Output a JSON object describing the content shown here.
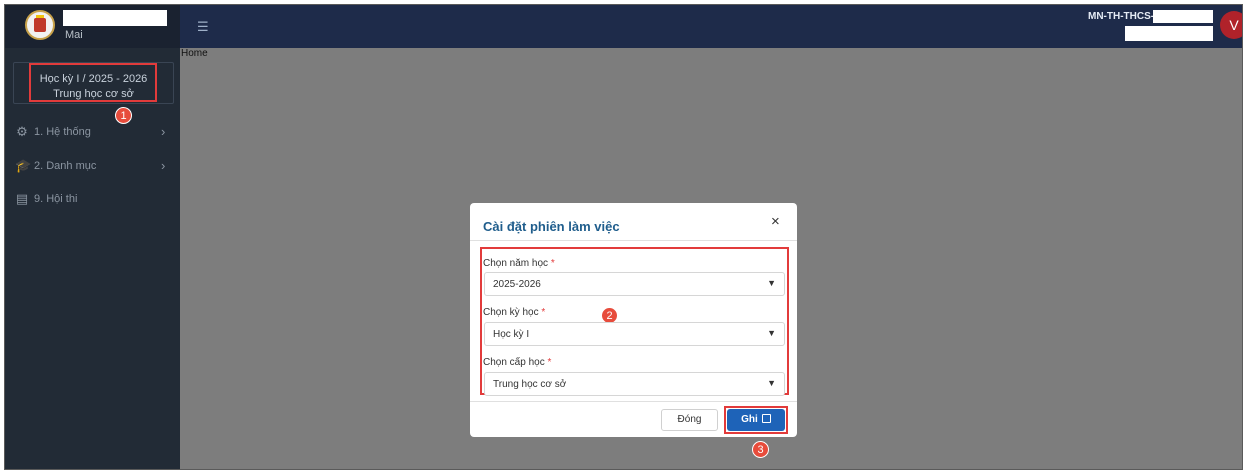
{
  "sidebar": {
    "user_sub": "Mai",
    "term_line1": "Học kỳ I / 2025 - 2026",
    "term_line2": "Trung học cơ sở",
    "items": [
      {
        "label": "1. Hệ thống",
        "icon": "gear-icon"
      },
      {
        "label": "2. Danh mục",
        "icon": "graduation-cap-icon"
      },
      {
        "label": "9. Hội thi",
        "icon": "document-icon"
      }
    ]
  },
  "topbar": {
    "org_code": "MN-TH-THCS-",
    "avatar_letter": "V"
  },
  "breadcrumb": {
    "home": "Home"
  },
  "dialog": {
    "title": "Cài đặt phiên làm việc",
    "close_glyph": "×",
    "fields": [
      {
        "label": "Chọn năm học",
        "required": "*",
        "value": "2025-2026"
      },
      {
        "label": "Chọn kỳ học",
        "required": "*",
        "value": "Học kỳ I"
      },
      {
        "label": "Chọn cấp học",
        "required": "*",
        "value": "Trung học cơ sở"
      }
    ],
    "btn_close": "Đóng",
    "btn_save": "Ghi"
  },
  "annotations": {
    "step1": "1",
    "step2": "2",
    "step3": "3"
  },
  "colors": {
    "sidebar_bg": "#222b36",
    "topbar_bg": "#1e2b4a",
    "overlay": "#7d7d7d",
    "accent": "#1e63b8",
    "highlight": "#e23b3b",
    "title": "#1f5d8c"
  }
}
